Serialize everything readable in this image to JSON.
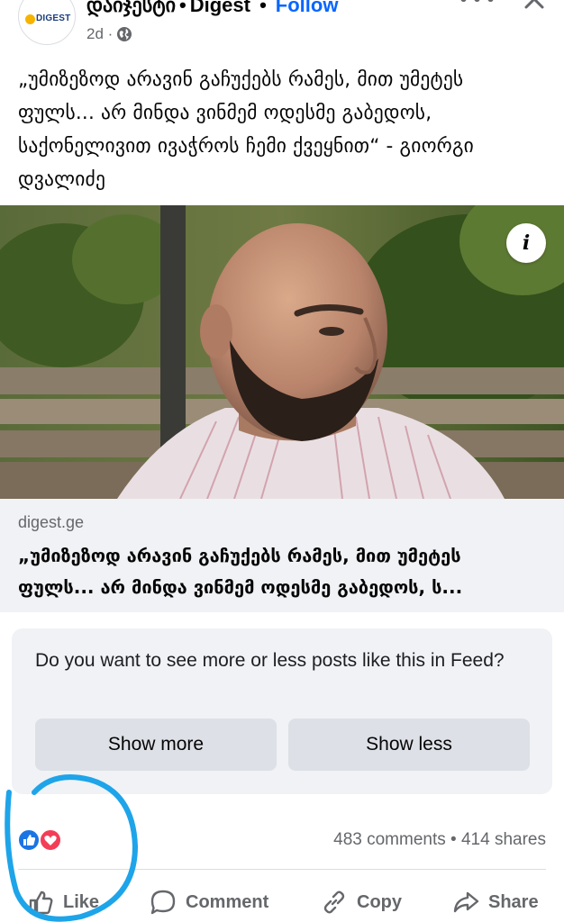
{
  "header": {
    "avatar_brand": "DIGEST",
    "page_name": "დაიჯესტი",
    "separator": "•",
    "page_name_en": "Digest",
    "dot": "•",
    "follow_label": "Follow",
    "time": "2d ·",
    "privacy_icon": "globe-icon",
    "more_icon": "more-horizontal-icon",
    "close_icon": "close-icon"
  },
  "post": {
    "text": "„უმიზეზოდ არავინ გაჩუქებს რამეს, მით უმეტეს ფულს... არ მინდა ვინმემ ოდესმე გაბედოს, საქონელივით ივაჭროს ჩემი ქვეყნით“ - გიორგი დვალიძე"
  },
  "photo": {
    "info_label": "i"
  },
  "link_preview": {
    "domain": "digest.ge",
    "title_line1": "„უმიზეზოდ არავინ გაჩუქებს რამეს, მით უმეტეს",
    "title_line2": "ფულს... არ მინდა ვინმემ ოდესმე გაბედოს, ს..."
  },
  "feedback": {
    "question": "Do you want to see more or less posts like this in Feed?",
    "show_more_label": "Show more",
    "show_less_label": "Show less"
  },
  "stats": {
    "comments": "483 comments",
    "dot": "•",
    "shares": "414 shares",
    "reaction_icons": [
      "like-reaction-icon",
      "love-reaction-icon"
    ]
  },
  "actions": {
    "like_label": "Like",
    "comment_label": "Comment",
    "copy_label": "Copy",
    "share_label": "Share"
  },
  "colors": {
    "accent": "#0866ff",
    "secondary_text": "#65676b",
    "card_bg": "#f0f2f5",
    "button_bg": "#dde0e6",
    "annotation": "#1ea4e9"
  }
}
